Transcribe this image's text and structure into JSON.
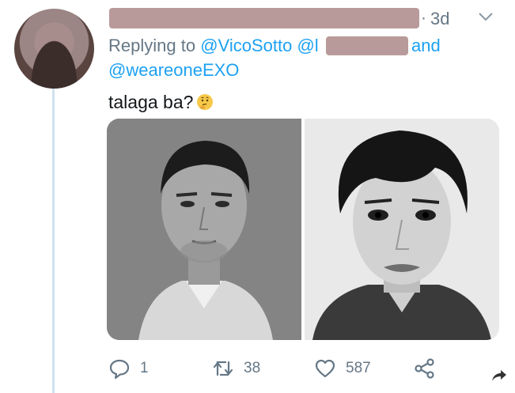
{
  "tweet": {
    "time_separator": "·",
    "timestamp": "3d",
    "replying_prefix": "Replying to",
    "mention_1": "@VicoSotto",
    "mention_2_visible": "@l",
    "and_word": "and",
    "mention_3": "@weareoneEXO",
    "text": "talaga ba?",
    "emoji_icon": "thinking-face-icon"
  },
  "actions": {
    "reply_count": "1",
    "retweet_count": "38",
    "like_count": "587"
  },
  "colors": {
    "link_blue": "#1da1f2",
    "muted_gray": "#657786",
    "redaction": "#b99a9a",
    "thread_line": "#cfe1ef"
  }
}
